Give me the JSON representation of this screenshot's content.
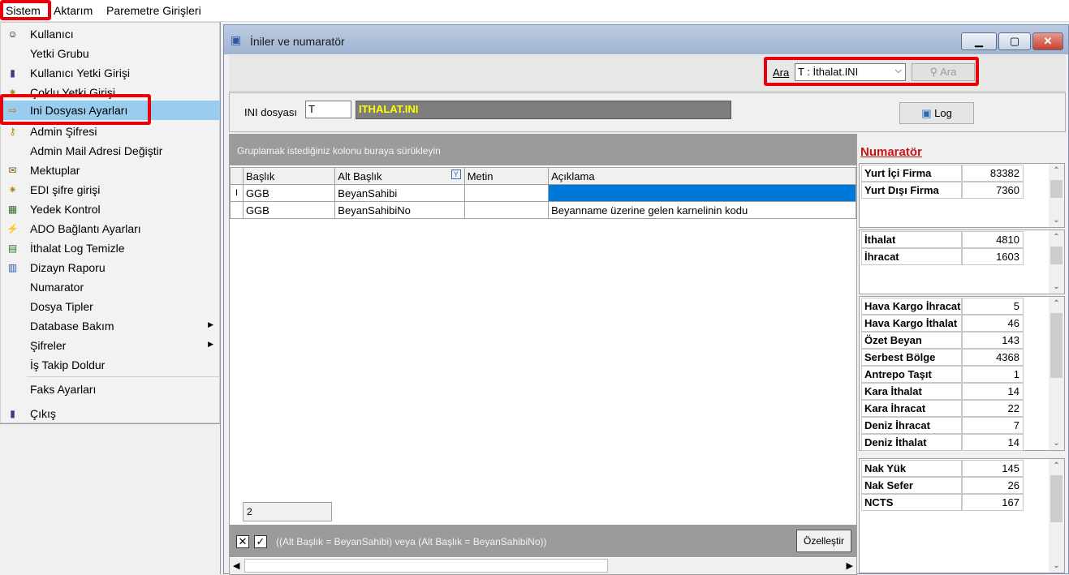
{
  "menubar": {
    "items": [
      "Sistem",
      "Aktarım",
      "Paremetre Girişleri"
    ]
  },
  "menu": {
    "items": [
      {
        "label": "Kullanıcı",
        "icon": "user-icon"
      },
      {
        "label": "Yetki Grubu",
        "icon": ""
      },
      {
        "label": "Kullanıcı Yetki Girişi",
        "icon": "door-icon"
      },
      {
        "label": "Çoklu Yetki Girişi",
        "icon": "keys-icon"
      },
      {
        "label": "Ini Dosyası  Ayarları",
        "icon": "settings-file-icon"
      },
      {
        "label": "Admin Şifresi",
        "icon": "key-icon"
      },
      {
        "label": "Admin Mail Adresi Değiştir",
        "icon": ""
      },
      {
        "label": "Mektuplar",
        "icon": "letter-icon"
      },
      {
        "label": "EDI şifre girişi",
        "icon": "keys-icon"
      },
      {
        "label": "Yedek Kontrol",
        "icon": "backup-icon"
      },
      {
        "label": "ADO Bağlantı Ayarları",
        "icon": "connection-icon"
      },
      {
        "label": "İthalat Log Temizle",
        "icon": "log-icon"
      },
      {
        "label": "Dizayn Raporu",
        "icon": "report-icon"
      },
      {
        "label": "Numarator",
        "icon": ""
      },
      {
        "label": "Dosya Tipler",
        "icon": ""
      },
      {
        "label": "Database Bakım",
        "icon": "",
        "submenu": true
      },
      {
        "label": "Şifreler",
        "icon": "",
        "submenu": true
      },
      {
        "label": "İş Takip Doldur",
        "icon": ""
      },
      {
        "label": "Faks Ayarları",
        "icon": ""
      },
      {
        "label": "Çıkış",
        "icon": "door-icon"
      }
    ]
  },
  "window": {
    "title": "İniler ve numaratör",
    "search": {
      "label": "Ara",
      "value": "T : İthalat.INI",
      "button": "Ara"
    },
    "ini": {
      "label": "INI dosyası",
      "code": "T",
      "name": "ITHALAT.INI"
    },
    "log_button": "Log",
    "group_hint": "Gruplamak istediğiniz kolonu buraya sürükleyin",
    "columns": [
      "Başlık",
      "Alt Başlık",
      "Metin",
      "Açıklama"
    ],
    "rows": [
      [
        "GGB",
        "BeyanSahibi",
        "",
        ""
      ],
      [
        "GGB",
        "BeyanSahibiNo",
        "",
        "Beyanname üzerine gelen karnelinin kodu"
      ]
    ],
    "row_count": "2",
    "filter_text": "((Alt Başlık = BeyanSahibi) veya (Alt Başlık = BeyanSahibiNo))",
    "customize_button": "Özelleştir"
  },
  "numarator": {
    "title": "Numaratör",
    "groups": [
      [
        {
          "k": "Yurt İçi Firma",
          "v": "83382"
        },
        {
          "k": "Yurt Dışı Firma",
          "v": "7360"
        }
      ],
      [
        {
          "k": "İthalat",
          "v": "4810"
        },
        {
          "k": "İhracat",
          "v": "1603"
        }
      ],
      [
        {
          "k": "Hava Kargo İhracat",
          "v": "5"
        },
        {
          "k": "Hava Kargo İthalat",
          "v": "46"
        },
        {
          "k": "Özet Beyan",
          "v": "143"
        },
        {
          "k": "Serbest Bölge",
          "v": "4368"
        },
        {
          "k": "Antrepo Taşıt",
          "v": "1"
        },
        {
          "k": "Kara İthalat",
          "v": "14"
        },
        {
          "k": "Kara İhracat",
          "v": "22"
        },
        {
          "k": "Deniz İhracat",
          "v": "7"
        },
        {
          "k": "Deniz İthalat",
          "v": "14"
        }
      ],
      [
        {
          "k": "Nak Yük",
          "v": "145"
        },
        {
          "k": "Nak Sefer",
          "v": "26"
        },
        {
          "k": "NCTS",
          "v": "167"
        }
      ]
    ]
  },
  "colors": {
    "highlight": "#e8000b",
    "selected_menu": "#99ccee",
    "selected_cell": "#0078d7",
    "ini_name_text": "#ffff00"
  }
}
